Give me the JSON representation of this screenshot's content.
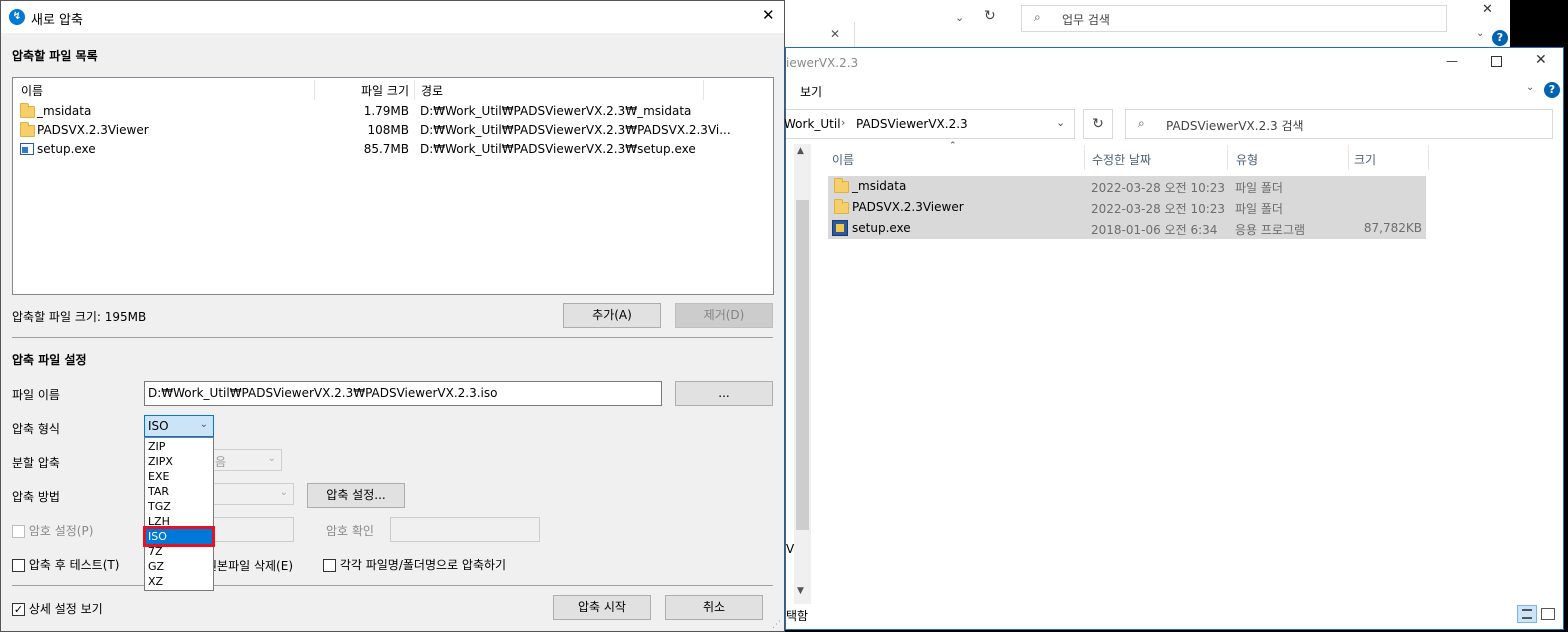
{
  "bg_explorer_top": {
    "search_placeholder": "업무 검색",
    "close_glyph": "✕",
    "help_glyph": "?"
  },
  "explorer": {
    "title": "iewerVX.2.3",
    "menu_view": "보기",
    "breadcrumb": [
      "Work_Util",
      "PADSViewerVX.2.3"
    ],
    "search_placeholder": "PADSViewerVX.2.3 검색",
    "columns": [
      "이름",
      "수정한 날짜",
      "유형",
      "크기"
    ],
    "rows": [
      {
        "name": "_msidata",
        "date": "2022-03-28 오전 10:23",
        "type": "파일 폴더",
        "size": "",
        "icon": "folder-icon"
      },
      {
        "name": "PADSVX.2.3Viewer",
        "date": "2022-03-28 오전 10:23",
        "type": "파일 폴더",
        "size": "",
        "icon": "folder-icon"
      },
      {
        "name": "setup.exe",
        "date": "2018-01-06 오전 6:34",
        "type": "응용 프로그램",
        "size": "87,782KB",
        "icon": "setup-icon"
      }
    ],
    "status_fragment": "택함",
    "left_letter": "V"
  },
  "dialog": {
    "title": "새로 압축",
    "section_files": "압축할 파일 목록",
    "columns": [
      "이름",
      "파일 크기",
      "경로"
    ],
    "files": [
      {
        "name": "_msidata",
        "size": "1.79MB",
        "path": "D:₩Work_Util₩PADSViewerVX.2.3₩_msidata",
        "icon": "folder-icon"
      },
      {
        "name": "PADSVX.2.3Viewer",
        "size": "108MB",
        "path": "D:₩Work_Util₩PADSViewerVX.2.3₩PADSVX.2.3Vi...",
        "icon": "folder-icon"
      },
      {
        "name": "setup.exe",
        "size": "85.7MB",
        "path": "D:₩Work_Util₩PADSViewerVX.2.3₩setup.exe",
        "icon": "exe-icon"
      }
    ],
    "total_size": "압축할 파일 크기: 195MB",
    "add_button": "추가(A)",
    "remove_button": "제거(D)",
    "section_settings": "압축 파일 설정",
    "filename_label": "파일 이름",
    "filename_value": "D:₩Work_Util₩PADSViewerVX.2.3₩PADSViewerVX.2.3.iso",
    "browse_button": "...",
    "format_label": "압축 형식",
    "format_value": "ISO",
    "split_label": "분할 압축",
    "split_value_fragment": "음",
    "method_label": "압축 방법",
    "method_settings_button": "압축 설정...",
    "password_label": "암호 설정(P)",
    "password_confirm_label": "암호 확인",
    "test_label": "압축 후 테스트(T)",
    "delete_label_fragment": "원본파일 삭제(E)",
    "each_label": "각각 파일명/폴더명으로 압축하기",
    "details_label": "상세 설정 보기",
    "details_check": "✓",
    "start_button": "압축 시작",
    "cancel_button": "취소",
    "format_options": [
      "ZIP",
      "ZIPX",
      "EXE",
      "TAR",
      "TGZ",
      "LZH",
      "ISO",
      "7Z",
      "GZ",
      "XZ"
    ],
    "format_selected": "ISO",
    "highlight_color": "#e81123",
    "accent": "#0078d7"
  }
}
